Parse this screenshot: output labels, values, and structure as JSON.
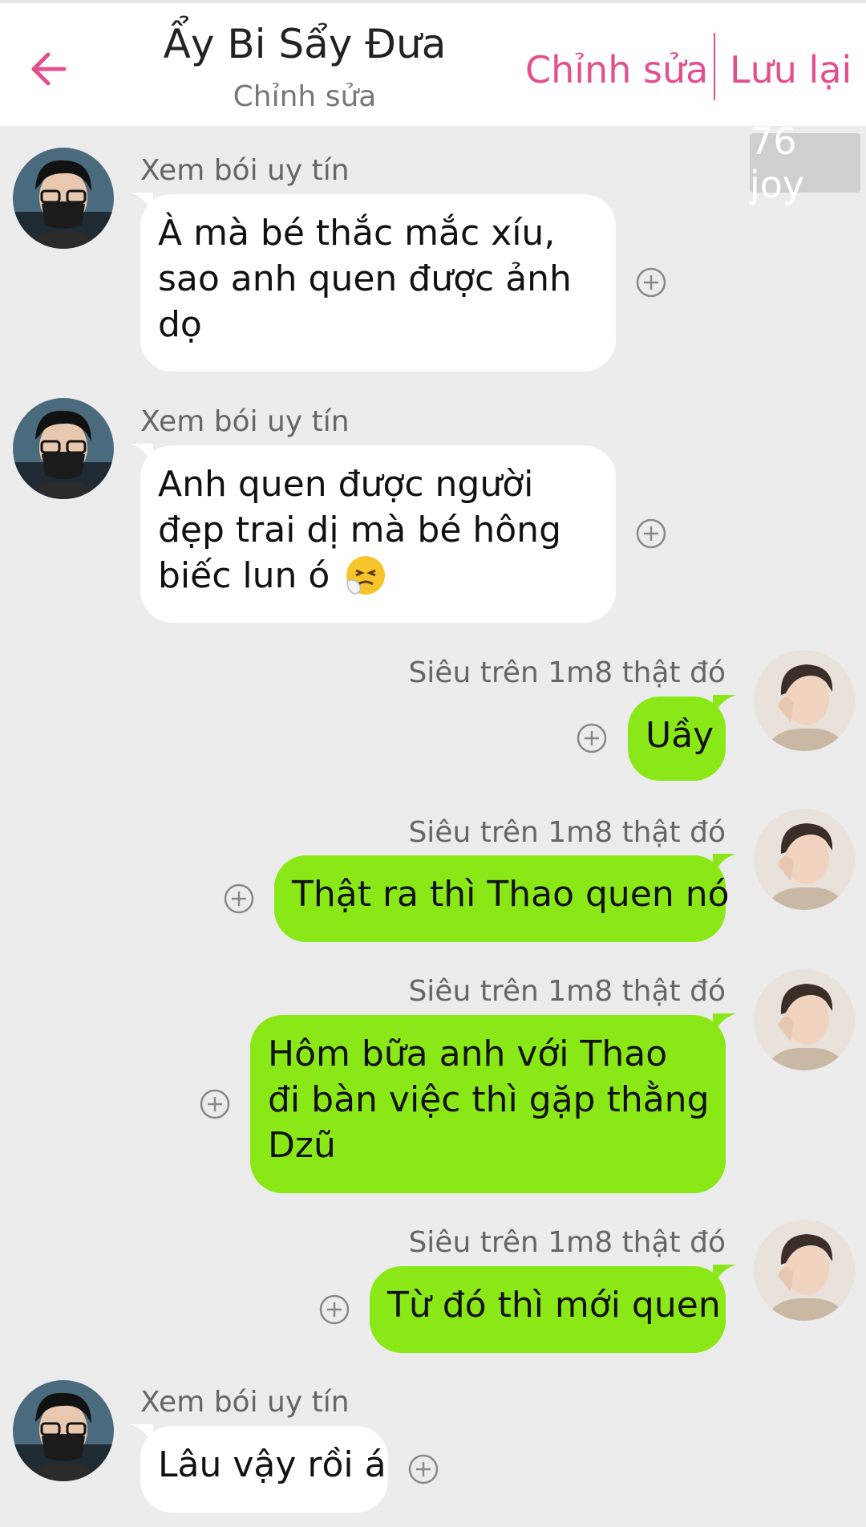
{
  "header": {
    "back_icon": "arrow-left-icon",
    "title": "Ẩy Bi Sẩy Đưa",
    "subtitle": "Chỉnh sửa",
    "edit_label": "Chỉnh sửa",
    "save_label": "Lưu lại",
    "accent_color": "#e34f8d"
  },
  "badge": {
    "text": "76 joy"
  },
  "colors": {
    "incoming_bubble": "#ffffff",
    "outgoing_bubble": "#8ae817",
    "background": "#ececec"
  },
  "messages": [
    {
      "sender": "Xem bói uy tín",
      "direction": "incoming",
      "lines": [
        "À mà bé thắc mắc xíu,",
        "sao anh quen được ảnh",
        "dọ"
      ]
    },
    {
      "sender": "Xem bói uy tín",
      "direction": "incoming",
      "lines": [
        "Anh quen được người",
        "đẹp trai dị mà bé hông",
        "biếc lun ó"
      ],
      "emoji": "sneezing-face-emoji"
    },
    {
      "sender": "Siêu trên 1m8 thật đó",
      "direction": "outgoing",
      "lines": [
        "Uầy"
      ]
    },
    {
      "sender": "Siêu trên 1m8 thật đó",
      "direction": "outgoing",
      "lines": [
        "Thật ra thì Thao quen nó"
      ]
    },
    {
      "sender": "Siêu trên 1m8 thật đó",
      "direction": "outgoing",
      "lines": [
        "Hôm bữa anh với Thao",
        "đi bàn việc thì gặp thằng",
        "Dzũ"
      ]
    },
    {
      "sender": "Siêu trên 1m8 thật đó",
      "direction": "outgoing",
      "lines": [
        "Từ đó thì mới quen"
      ]
    },
    {
      "sender": "Xem bói uy tín",
      "direction": "incoming",
      "lines": [
        "Lâu vậy rồi á"
      ]
    }
  ]
}
